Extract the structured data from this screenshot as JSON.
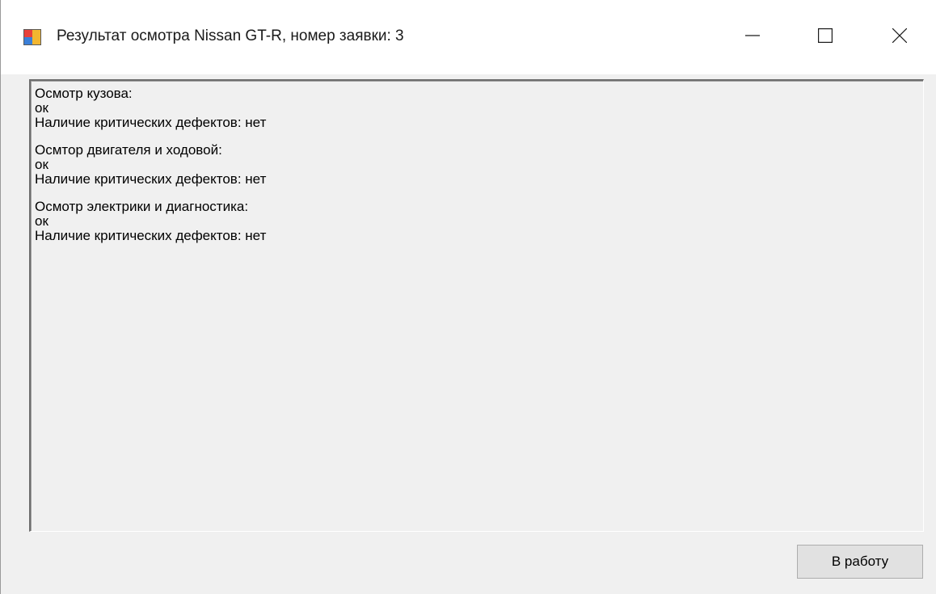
{
  "window": {
    "title": "Результат осмотра Nissan GT-R, номер заявки: 3",
    "icon": "app-window-icon",
    "caption_buttons": [
      "minimize-icon",
      "maximize-icon",
      "close-icon"
    ]
  },
  "report": {
    "sections": [
      {
        "heading": "Осмотр кузова:",
        "result": "ок",
        "critical": "Наличие критических дефектов: нет"
      },
      {
        "heading": "Осмтор двигателя и ходовой:",
        "result": "ок",
        "critical": "Наличие критических дефектов: нет"
      },
      {
        "heading": "Осмотр электрики и диагностика:",
        "result": "ок",
        "critical": "Наличие критических дефектов: нет"
      }
    ]
  },
  "actions": {
    "to_work_label": "В работу"
  },
  "colors": {
    "background": "#f0f0f0",
    "titlebar": "#ffffff",
    "button_face": "#e1e1e1"
  }
}
